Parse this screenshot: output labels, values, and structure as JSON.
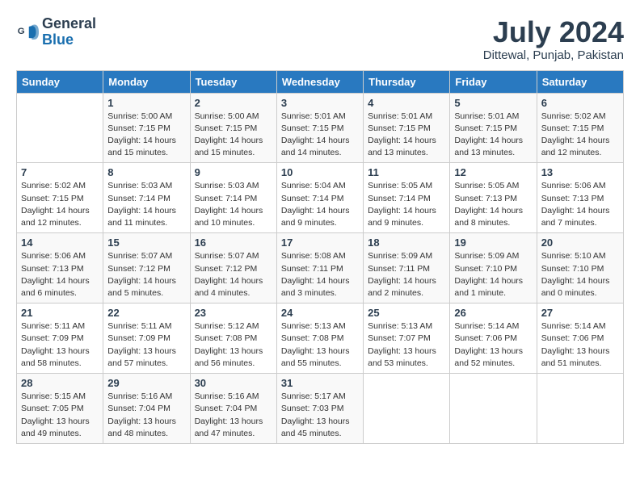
{
  "header": {
    "logo_line1": "General",
    "logo_line2": "Blue",
    "month_title": "July 2024",
    "location": "Dittewal, Punjab, Pakistan"
  },
  "weekdays": [
    "Sunday",
    "Monday",
    "Tuesday",
    "Wednesday",
    "Thursday",
    "Friday",
    "Saturday"
  ],
  "weeks": [
    [
      {
        "day": "",
        "info": ""
      },
      {
        "day": "1",
        "info": "Sunrise: 5:00 AM\nSunset: 7:15 PM\nDaylight: 14 hours\nand 15 minutes."
      },
      {
        "day": "2",
        "info": "Sunrise: 5:00 AM\nSunset: 7:15 PM\nDaylight: 14 hours\nand 15 minutes."
      },
      {
        "day": "3",
        "info": "Sunrise: 5:01 AM\nSunset: 7:15 PM\nDaylight: 14 hours\nand 14 minutes."
      },
      {
        "day": "4",
        "info": "Sunrise: 5:01 AM\nSunset: 7:15 PM\nDaylight: 14 hours\nand 13 minutes."
      },
      {
        "day": "5",
        "info": "Sunrise: 5:01 AM\nSunset: 7:15 PM\nDaylight: 14 hours\nand 13 minutes."
      },
      {
        "day": "6",
        "info": "Sunrise: 5:02 AM\nSunset: 7:15 PM\nDaylight: 14 hours\nand 12 minutes."
      }
    ],
    [
      {
        "day": "7",
        "info": "Sunrise: 5:02 AM\nSunset: 7:15 PM\nDaylight: 14 hours\nand 12 minutes."
      },
      {
        "day": "8",
        "info": "Sunrise: 5:03 AM\nSunset: 7:14 PM\nDaylight: 14 hours\nand 11 minutes."
      },
      {
        "day": "9",
        "info": "Sunrise: 5:03 AM\nSunset: 7:14 PM\nDaylight: 14 hours\nand 10 minutes."
      },
      {
        "day": "10",
        "info": "Sunrise: 5:04 AM\nSunset: 7:14 PM\nDaylight: 14 hours\nand 9 minutes."
      },
      {
        "day": "11",
        "info": "Sunrise: 5:05 AM\nSunset: 7:14 PM\nDaylight: 14 hours\nand 9 minutes."
      },
      {
        "day": "12",
        "info": "Sunrise: 5:05 AM\nSunset: 7:13 PM\nDaylight: 14 hours\nand 8 minutes."
      },
      {
        "day": "13",
        "info": "Sunrise: 5:06 AM\nSunset: 7:13 PM\nDaylight: 14 hours\nand 7 minutes."
      }
    ],
    [
      {
        "day": "14",
        "info": "Sunrise: 5:06 AM\nSunset: 7:13 PM\nDaylight: 14 hours\nand 6 minutes."
      },
      {
        "day": "15",
        "info": "Sunrise: 5:07 AM\nSunset: 7:12 PM\nDaylight: 14 hours\nand 5 minutes."
      },
      {
        "day": "16",
        "info": "Sunrise: 5:07 AM\nSunset: 7:12 PM\nDaylight: 14 hours\nand 4 minutes."
      },
      {
        "day": "17",
        "info": "Sunrise: 5:08 AM\nSunset: 7:11 PM\nDaylight: 14 hours\nand 3 minutes."
      },
      {
        "day": "18",
        "info": "Sunrise: 5:09 AM\nSunset: 7:11 PM\nDaylight: 14 hours\nand 2 minutes."
      },
      {
        "day": "19",
        "info": "Sunrise: 5:09 AM\nSunset: 7:10 PM\nDaylight: 14 hours\nand 1 minute."
      },
      {
        "day": "20",
        "info": "Sunrise: 5:10 AM\nSunset: 7:10 PM\nDaylight: 14 hours\nand 0 minutes."
      }
    ],
    [
      {
        "day": "21",
        "info": "Sunrise: 5:11 AM\nSunset: 7:09 PM\nDaylight: 13 hours\nand 58 minutes."
      },
      {
        "day": "22",
        "info": "Sunrise: 5:11 AM\nSunset: 7:09 PM\nDaylight: 13 hours\nand 57 minutes."
      },
      {
        "day": "23",
        "info": "Sunrise: 5:12 AM\nSunset: 7:08 PM\nDaylight: 13 hours\nand 56 minutes."
      },
      {
        "day": "24",
        "info": "Sunrise: 5:13 AM\nSunset: 7:08 PM\nDaylight: 13 hours\nand 55 minutes."
      },
      {
        "day": "25",
        "info": "Sunrise: 5:13 AM\nSunset: 7:07 PM\nDaylight: 13 hours\nand 53 minutes."
      },
      {
        "day": "26",
        "info": "Sunrise: 5:14 AM\nSunset: 7:06 PM\nDaylight: 13 hours\nand 52 minutes."
      },
      {
        "day": "27",
        "info": "Sunrise: 5:14 AM\nSunset: 7:06 PM\nDaylight: 13 hours\nand 51 minutes."
      }
    ],
    [
      {
        "day": "28",
        "info": "Sunrise: 5:15 AM\nSunset: 7:05 PM\nDaylight: 13 hours\nand 49 minutes."
      },
      {
        "day": "29",
        "info": "Sunrise: 5:16 AM\nSunset: 7:04 PM\nDaylight: 13 hours\nand 48 minutes."
      },
      {
        "day": "30",
        "info": "Sunrise: 5:16 AM\nSunset: 7:04 PM\nDaylight: 13 hours\nand 47 minutes."
      },
      {
        "day": "31",
        "info": "Sunrise: 5:17 AM\nSunset: 7:03 PM\nDaylight: 13 hours\nand 45 minutes."
      },
      {
        "day": "",
        "info": ""
      },
      {
        "day": "",
        "info": ""
      },
      {
        "day": "",
        "info": ""
      }
    ]
  ]
}
